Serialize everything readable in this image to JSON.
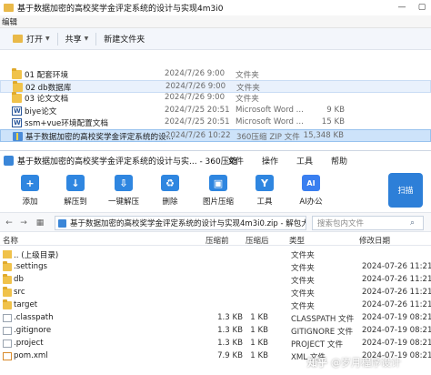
{
  "explorer": {
    "title": "基于数据加密的高校奖学金评定系统的设计与实现4m3i0",
    "menu": [
      "编辑"
    ],
    "toolbar": {
      "open": "打开",
      "share": "共享",
      "new_folder": "新建文件夹"
    },
    "files": [
      {
        "name": "01 配套环境",
        "date": "2024/7/26 9:00",
        "type": "文件夹",
        "size": "",
        "icon": "folder-icon"
      },
      {
        "name": "02 db数据库",
        "date": "2024/7/26 9:00",
        "type": "文件夹",
        "size": "",
        "icon": "folder-icon"
      },
      {
        "name": "03 论文文档",
        "date": "2024/7/26 9:00",
        "type": "文件夹",
        "size": "",
        "icon": "folder-icon"
      },
      {
        "name": "biye论文",
        "date": "2024/7/25 20:51",
        "type": "Microsoft Word ...",
        "size": "9 KB",
        "icon": "word-doc-icon"
      },
      {
        "name": "ssm+vue环境配置文档",
        "date": "2024/7/25 20:51",
        "type": "Microsoft Word ...",
        "size": "15 KB",
        "icon": "word-doc-icon"
      },
      {
        "name": "基于数据加密的高校奖学金评定系统的设...",
        "date": "2024/7/26 10:22",
        "type": "360压缩 ZIP 文件",
        "size": "15,348 KB",
        "icon": "zip-file-icon"
      }
    ]
  },
  "zip": {
    "title": "基于数据加密的高校奖学金评定系统的设计与实... - 360压缩",
    "menu": [
      "文件",
      "操作",
      "工具",
      "帮助"
    ],
    "ribbon": [
      {
        "label": "添加",
        "icon": "add-icon",
        "color": "#2f86e0",
        "glyph": "+"
      },
      {
        "label": "解压到",
        "icon": "extract-to-icon",
        "color": "#2f86e0",
        "glyph": "↓"
      },
      {
        "label": "一键解压",
        "icon": "one-click-extract-icon",
        "color": "#2f86e0",
        "glyph": "⇩"
      },
      {
        "label": "删除",
        "icon": "delete-icon",
        "color": "#2f86e0",
        "glyph": "♻"
      },
      {
        "label": "图片压缩",
        "icon": "image-compress-icon",
        "color": "#2f86e0",
        "glyph": "▣"
      },
      {
        "label": "工具",
        "icon": "tools-icon",
        "color": "#2f86e0",
        "glyph": "Y"
      },
      {
        "label": "AI办公",
        "icon": "ai-office-icon",
        "color": "#3a7ff0",
        "glyph": "AI"
      }
    ],
    "scan": "扫描",
    "address": "基于数据加密的高校奖学金评定系统的设计与实现4m3i0.zip - 解包大",
    "search_placeholder": "搜索包内文件",
    "columns": {
      "name": "名称",
      "size": "压缩前",
      "packed": "压缩后",
      "type": "类型",
      "date": "修改日期"
    },
    "rows": [
      {
        "name": ".. (上级目录)",
        "size": "",
        "packed": "",
        "type": "文件夹",
        "date": "",
        "icon": "parent-folder-icon"
      },
      {
        "name": ".settings",
        "size": "",
        "packed": "",
        "type": "文件夹",
        "date": "2024-07-26 11:21",
        "icon": "folder-icon"
      },
      {
        "name": "db",
        "size": "",
        "packed": "",
        "type": "文件夹",
        "date": "2024-07-26 11:21",
        "icon": "folder-icon"
      },
      {
        "name": "src",
        "size": "",
        "packed": "",
        "type": "文件夹",
        "date": "2024-07-26 11:21",
        "icon": "folder-icon"
      },
      {
        "name": "target",
        "size": "",
        "packed": "",
        "type": "文件夹",
        "date": "2024-07-26 11:21",
        "icon": "folder-icon"
      },
      {
        "name": ".classpath",
        "size": "1.3 KB",
        "packed": "1 KB",
        "type": "CLASSPATH 文件",
        "date": "2024-07-19 08:21",
        "icon": "file-icon"
      },
      {
        "name": ".gitignore",
        "size": "1.3 KB",
        "packed": "1 KB",
        "type": "GITIGNORE 文件",
        "date": "2024-07-19 08:21",
        "icon": "file-icon"
      },
      {
        "name": ".project",
        "size": "1.3 KB",
        "packed": "1 KB",
        "type": "PROJECT 文件",
        "date": "2024-07-19 08:21",
        "icon": "file-icon"
      },
      {
        "name": "pom.xml",
        "size": "7.9 KB",
        "packed": "1 KB",
        "type": "XML 文件",
        "date": "2024-07-19 08:21",
        "icon": "xml-file-icon"
      }
    ]
  },
  "watermark": {
    "left": "知乎",
    "right": "@岁月程序设计"
  }
}
